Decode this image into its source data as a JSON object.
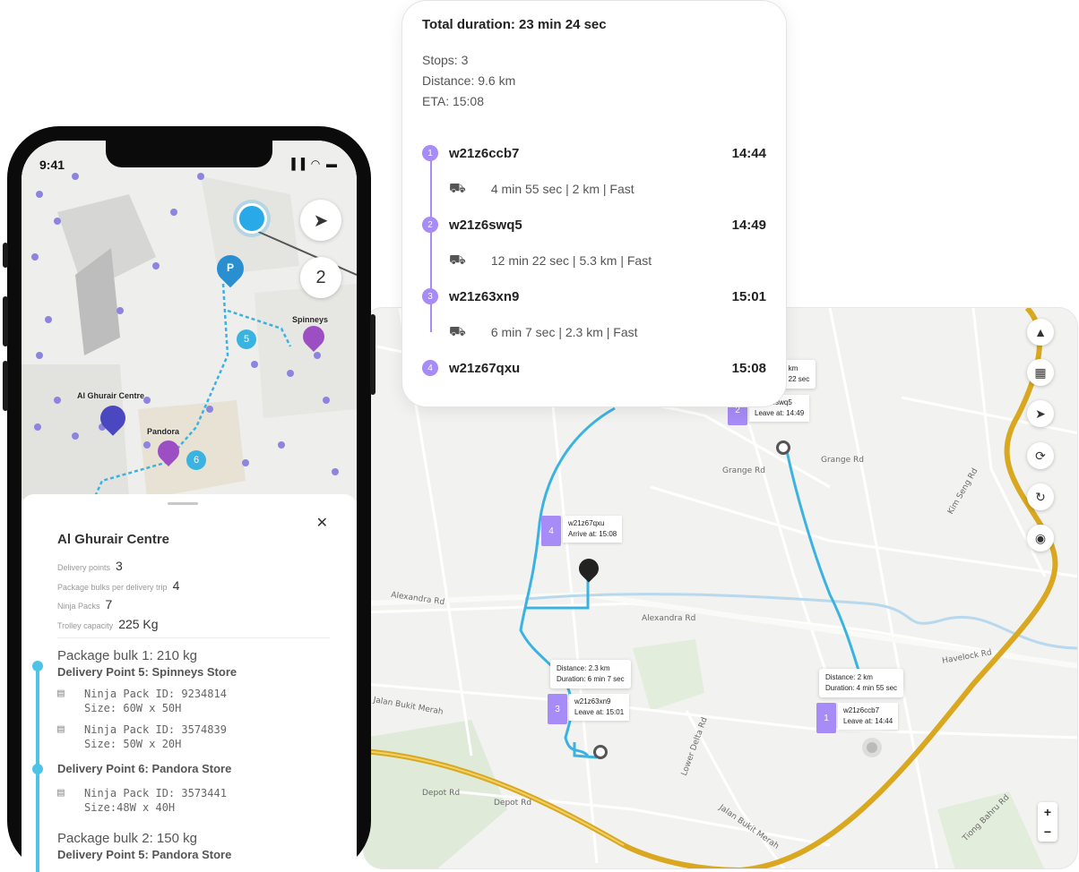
{
  "summary": {
    "total_duration": "Total duration: 23 min 24 sec",
    "stops": "Stops: 3",
    "distance": "Distance: 9.6 km",
    "eta": "ETA: 15:08",
    "stops_list": [
      {
        "num": "1",
        "code": "w21z6ccb7",
        "time": "14:44"
      },
      {
        "num": "2",
        "code": "w21z6swq5",
        "time": "14:49"
      },
      {
        "num": "3",
        "code": "w21z63xn9",
        "time": "15:01"
      },
      {
        "num": "4",
        "code": "w21z67qxu",
        "time": "15:08"
      }
    ],
    "legs": [
      "4 min 55 sec | 2 km | Fast",
      "12 min 22 sec | 5.3 km | Fast",
      "6 min 7 sec | 2.3 km | Fast"
    ]
  },
  "phone": {
    "status_time": "9:41",
    "status_icons": "▐▐ ◠ ▬",
    "recenter_icon": "navigation-arrow-icon",
    "count_button": "2",
    "map_labels": {
      "spinneys": "Spinneys",
      "al_ghurair": "Al Ghurair Centre",
      "pandora": "Pandora",
      "badge_5": "5",
      "badge_6": "6",
      "parking": "P"
    },
    "sheet": {
      "title": "Al Ghurair Centre",
      "close": "✕",
      "delivery_points_label": "Delivery points",
      "delivery_points_value": "3",
      "package_bulks_label": "Package bulks per delivery trip",
      "package_bulks_value": "4",
      "ninja_packs_label": "Ninja Packs",
      "ninja_packs_value": "7",
      "trolley_label": "Trolley capacity",
      "trolley_value": "225 Kg",
      "bulk1": "Package bulk 1: 210 kg",
      "dp5": "Delivery Point 5: Spinneys Store",
      "pack1_id": "Ninja Pack ID: 9234814",
      "pack1_size": "Size: 60W x 50H",
      "pack2_id": "Ninja Pack ID: 3574839",
      "pack2_size": "Size: 50W x 20H",
      "dp6": "Delivery Point 6: Pandora Store",
      "pack3_id": "Ninja Pack ID: 3573441",
      "pack3_size": "Size:48W x 40H",
      "bulk2": "Package bulk 2: 150 kg",
      "dp5b": "Delivery Point 5: Pandora Store"
    }
  },
  "map": {
    "controls": [
      "compass-icon",
      "layers-icon",
      "navigation-arrow-icon",
      "rotate-icon",
      "refresh-icon",
      "eye-off-icon"
    ],
    "zoom_in": "+",
    "zoom_out": "−",
    "road_labels": {
      "grange_rd": "Grange Rd",
      "grange_rd2": "Grange Rd",
      "alexandra_rd": "Alexandra Rd",
      "alexandra_rd2": "Alexandra Rd",
      "jalan_bukit_merah": "Jalan Bukit Merah",
      "depot_rd": "Depot Rd",
      "depot_rd2": "Depot Rd",
      "havelock_rd": "Havelock Rd",
      "tiong_bahru": "Tiong Bahru Rd",
      "lower_delta": "Lower Delta Rd",
      "jalan_bukit_merah2": "Jalan Bukit Merah",
      "kim_seng": "Kim Seng Rd"
    },
    "tips": {
      "tip_top": "2 km\nn 22 sec",
      "tip_left_1": "Distance: 2.3 km",
      "tip_left_2": "Duration: 6 min 7 sec",
      "tip_right_1": "Distance: 2 km",
      "tip_right_2": "Duration: 4 min 55 sec"
    },
    "flags": {
      "f2_num": "2",
      "f2_code": "w21z6swq5",
      "f2_sub": "Leave at: 14:49",
      "f4_num": "4",
      "f4_code": "w21z67qxu",
      "f4_sub": "Arrive at: 15:08",
      "f3_num": "3",
      "f3_code": "w21z63xn9",
      "f3_sub": "Leave at: 15:01",
      "f1_num": "1",
      "f1_code": "w21z6ccb7",
      "f1_sub": "Leave at: 14:44"
    }
  },
  "colors": {
    "accent_purple": "#a78bf6",
    "route_blue": "#3bb3e0",
    "highway_gold": "#d9a820"
  }
}
